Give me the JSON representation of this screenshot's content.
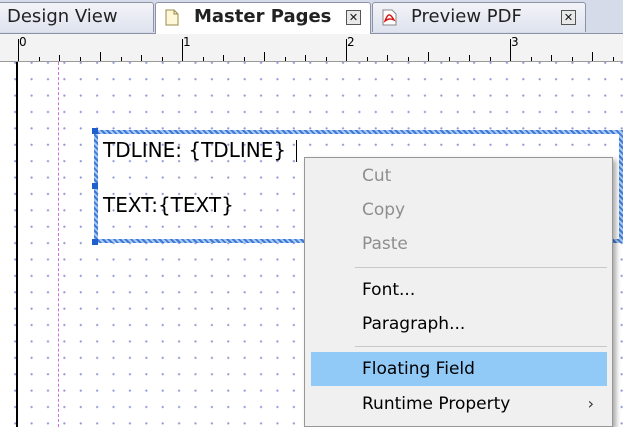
{
  "tabs": [
    {
      "label": "Design View",
      "active": false
    },
    {
      "label": "Master Pages",
      "active": true,
      "icon": "document-page-icon"
    },
    {
      "label": "Preview PDF",
      "active": false,
      "icon": "pdf-icon"
    }
  ],
  "tab_close_glyph": "✕",
  "ruler": {
    "labels": [
      "0",
      "1",
      "2",
      "3"
    ]
  },
  "band": {
    "fields": [
      {
        "text": "TDLINE: {TDLINE}"
      },
      {
        "text": "TEXT:{TEXT}"
      }
    ]
  },
  "context_menu": {
    "items": [
      {
        "label": "Cut",
        "enabled": false
      },
      {
        "label": "Copy",
        "enabled": false
      },
      {
        "label": "Paste",
        "enabled": false
      },
      {
        "label": "Font...",
        "enabled": true
      },
      {
        "label": "Paragraph...",
        "enabled": true
      },
      {
        "label": "Floating Field",
        "enabled": true,
        "highlighted": true
      },
      {
        "label": "Runtime Property",
        "enabled": true,
        "submenu": true
      }
    ],
    "submenu_glyph": "›"
  },
  "colors": {
    "highlight": "#91c9f7",
    "grid_dot": "#8f9ad6",
    "band_border": "#3d7bd6",
    "disabled_text": "#8e8e8e"
  }
}
